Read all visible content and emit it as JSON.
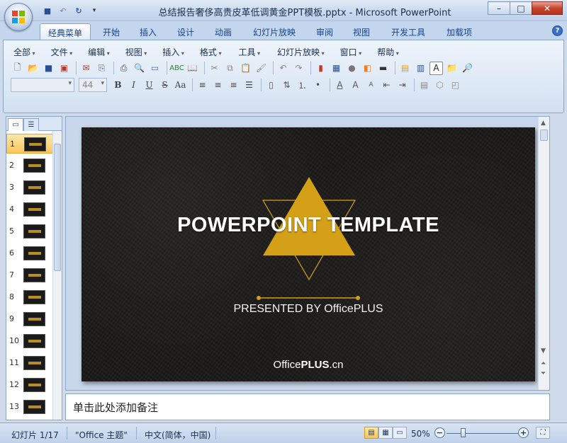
{
  "window": {
    "title": "总结报告奢侈高贵皮革低调黄金PPT模板.pptx - Microsoft PowerPoint",
    "minimize": "–",
    "maximize": "□",
    "close": "✕"
  },
  "qat": {
    "save_icon": "💾",
    "undo_icon": "↶",
    "redo_icon": "↷",
    "customize_icon": "▾"
  },
  "tabs": [
    {
      "label": "经典菜单",
      "active": true
    },
    {
      "label": "开始"
    },
    {
      "label": "插入"
    },
    {
      "label": "设计"
    },
    {
      "label": "动画"
    },
    {
      "label": "幻灯片放映"
    },
    {
      "label": "审阅"
    },
    {
      "label": "视图"
    },
    {
      "label": "开发工具"
    },
    {
      "label": "加载项"
    }
  ],
  "help_label": "?",
  "menu": [
    "全部",
    "文件",
    "编辑",
    "视图",
    "插入",
    "格式",
    "工具",
    "幻灯片放映",
    "窗口",
    "帮助"
  ],
  "toolbar": {
    "font_size_value": "44"
  },
  "format_buttons": {
    "bold": "B",
    "italic": "I",
    "underline": "U",
    "shadow": "S",
    "case": "Aa"
  },
  "left_panel": {
    "slide_numbers": [
      "1",
      "2",
      "3",
      "4",
      "5",
      "6",
      "7",
      "8",
      "9",
      "10",
      "11",
      "12",
      "13"
    ],
    "selected": 1
  },
  "slide": {
    "title": "POWERPOINT TEMPLATE",
    "subtitle": "PRESENTED BY OfficePLUS",
    "brand_prefix": "Office",
    "brand_bold": "PLUS",
    "brand_suffix": ".cn",
    "accent_color": "#d4a017"
  },
  "notes_placeholder": "单击此处添加备注",
  "status": {
    "slide_info": "幻灯片 1/17",
    "theme": "\"Office 主题\"",
    "language": "中文(简体，中国)",
    "zoom": "50%",
    "zoom_minus": "−",
    "zoom_plus": "+"
  }
}
